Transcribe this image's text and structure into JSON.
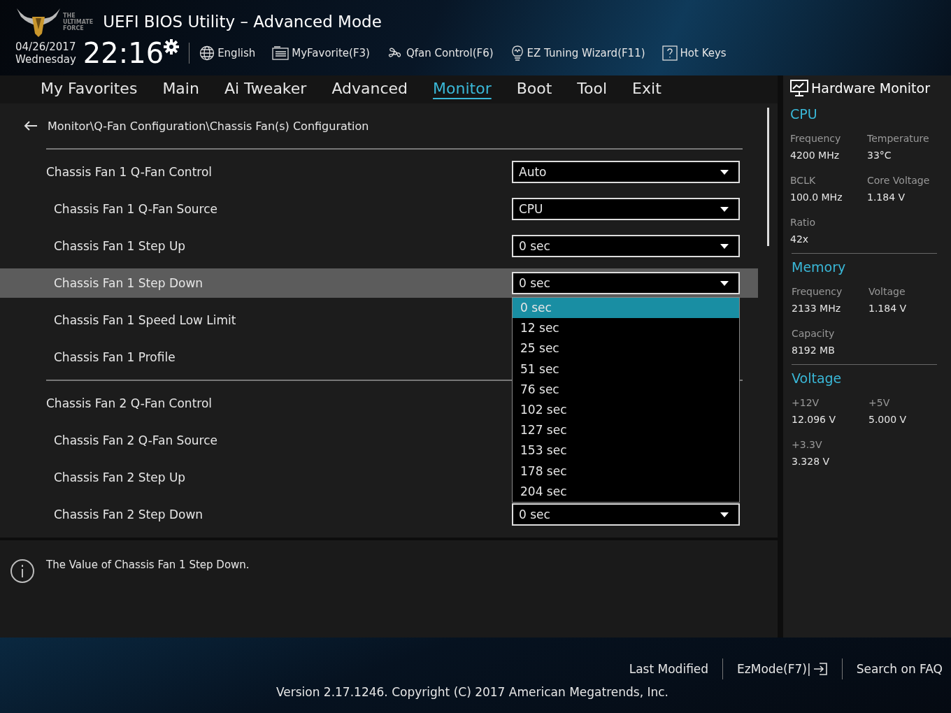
{
  "header": {
    "logo_text": [
      "THE",
      "ULTIMATE",
      "FORCE"
    ],
    "title": "UEFI BIOS Utility – Advanced Mode",
    "date": "04/26/2017",
    "day": "Wednesday",
    "time": "22:16",
    "tools": [
      {
        "kind": "globe",
        "label": "English"
      },
      {
        "kind": "list",
        "label": "MyFavorite(F3)"
      },
      {
        "kind": "fan",
        "label": "Qfan Control(F6)"
      },
      {
        "kind": "bulb",
        "label": "EZ Tuning Wizard(F11)"
      },
      {
        "kind": "help",
        "label": "Hot Keys"
      }
    ]
  },
  "tabs": [
    {
      "label": "My Favorites",
      "selected": false
    },
    {
      "label": "Main",
      "selected": false
    },
    {
      "label": "Ai Tweaker",
      "selected": false
    },
    {
      "label": "Advanced",
      "selected": false
    },
    {
      "label": "Monitor",
      "selected": true
    },
    {
      "label": "Boot",
      "selected": false
    },
    {
      "label": "Tool",
      "selected": false
    },
    {
      "label": "Exit",
      "selected": false
    }
  ],
  "breadcrumb": "Monitor\\Q-Fan Configuration\\Chassis Fan(s) Configuration",
  "rows": [
    {
      "kind": "group",
      "label": "Chassis Fan 1 Q-Fan Control",
      "value": "Auto",
      "selected": false
    },
    {
      "kind": "item",
      "label": "Chassis Fan 1 Q-Fan Source",
      "value": "CPU",
      "selected": false
    },
    {
      "kind": "item",
      "label": "Chassis Fan 1 Step Up",
      "value": "0 sec",
      "selected": false
    },
    {
      "kind": "item",
      "label": "Chassis Fan 1 Step Down",
      "value": "0 sec",
      "selected": true,
      "options": [
        {
          "label": "0 sec",
          "selected": true
        },
        {
          "label": "12 sec",
          "selected": false
        },
        {
          "label": "25 sec",
          "selected": false
        },
        {
          "label": "51 sec",
          "selected": false
        },
        {
          "label": "76 sec",
          "selected": false
        },
        {
          "label": "102 sec",
          "selected": false
        },
        {
          "label": "127 sec",
          "selected": false
        },
        {
          "label": "153 sec",
          "selected": false
        },
        {
          "label": "178 sec",
          "selected": false
        },
        {
          "label": "204 sec",
          "selected": false
        }
      ]
    },
    {
      "kind": "item",
      "label": "Chassis Fan 1 Speed Low Limit",
      "selected": false
    },
    {
      "kind": "item",
      "label": "Chassis Fan 1 Profile",
      "selected": false
    },
    {
      "kind": "group",
      "label": "Chassis Fan 2 Q-Fan Control",
      "selected": false
    },
    {
      "kind": "item",
      "label": "Chassis Fan 2 Q-Fan Source",
      "selected": false
    },
    {
      "kind": "item",
      "label": "Chassis Fan 2 Step Up",
      "selected": false
    },
    {
      "kind": "item",
      "label": "Chassis Fan 2 Step Down",
      "value": "0 sec",
      "selected": false
    }
  ],
  "help_text": "The Value of Chassis Fan 1 Step Down.",
  "hardware_monitor": {
    "title": "Hardware Monitor",
    "sections": [
      {
        "title": "CPU",
        "items": [
          {
            "label": "Frequency",
            "value": "4200 MHz"
          },
          {
            "label": "Temperature",
            "value": "33°C"
          },
          {
            "label": "BCLK",
            "value": "100.0 MHz"
          },
          {
            "label": "Core Voltage",
            "value": "1.184 V"
          },
          {
            "label": "Ratio",
            "value": "42x"
          }
        ]
      },
      {
        "title": "Memory",
        "items": [
          {
            "label": "Frequency",
            "value": "2133 MHz"
          },
          {
            "label": "Voltage",
            "value": "1.184 V"
          },
          {
            "label": "Capacity",
            "value": "8192 MB"
          }
        ]
      },
      {
        "title": "Voltage",
        "items": [
          {
            "label": "+12V",
            "value": "12.096 V"
          },
          {
            "label": "+5V",
            "value": "5.000 V"
          },
          {
            "label": "+3.3V",
            "value": "3.328 V"
          }
        ]
      }
    ]
  },
  "footer": {
    "links": [
      {
        "kind": "text",
        "label": "Last Modified"
      },
      {
        "kind": "ezmode",
        "label": "EzMode(F7)|"
      },
      {
        "kind": "text",
        "label": "Search on FAQ"
      }
    ],
    "version": "Version 2.17.1246. Copyright (C) 2017 American Megatrends, Inc."
  }
}
